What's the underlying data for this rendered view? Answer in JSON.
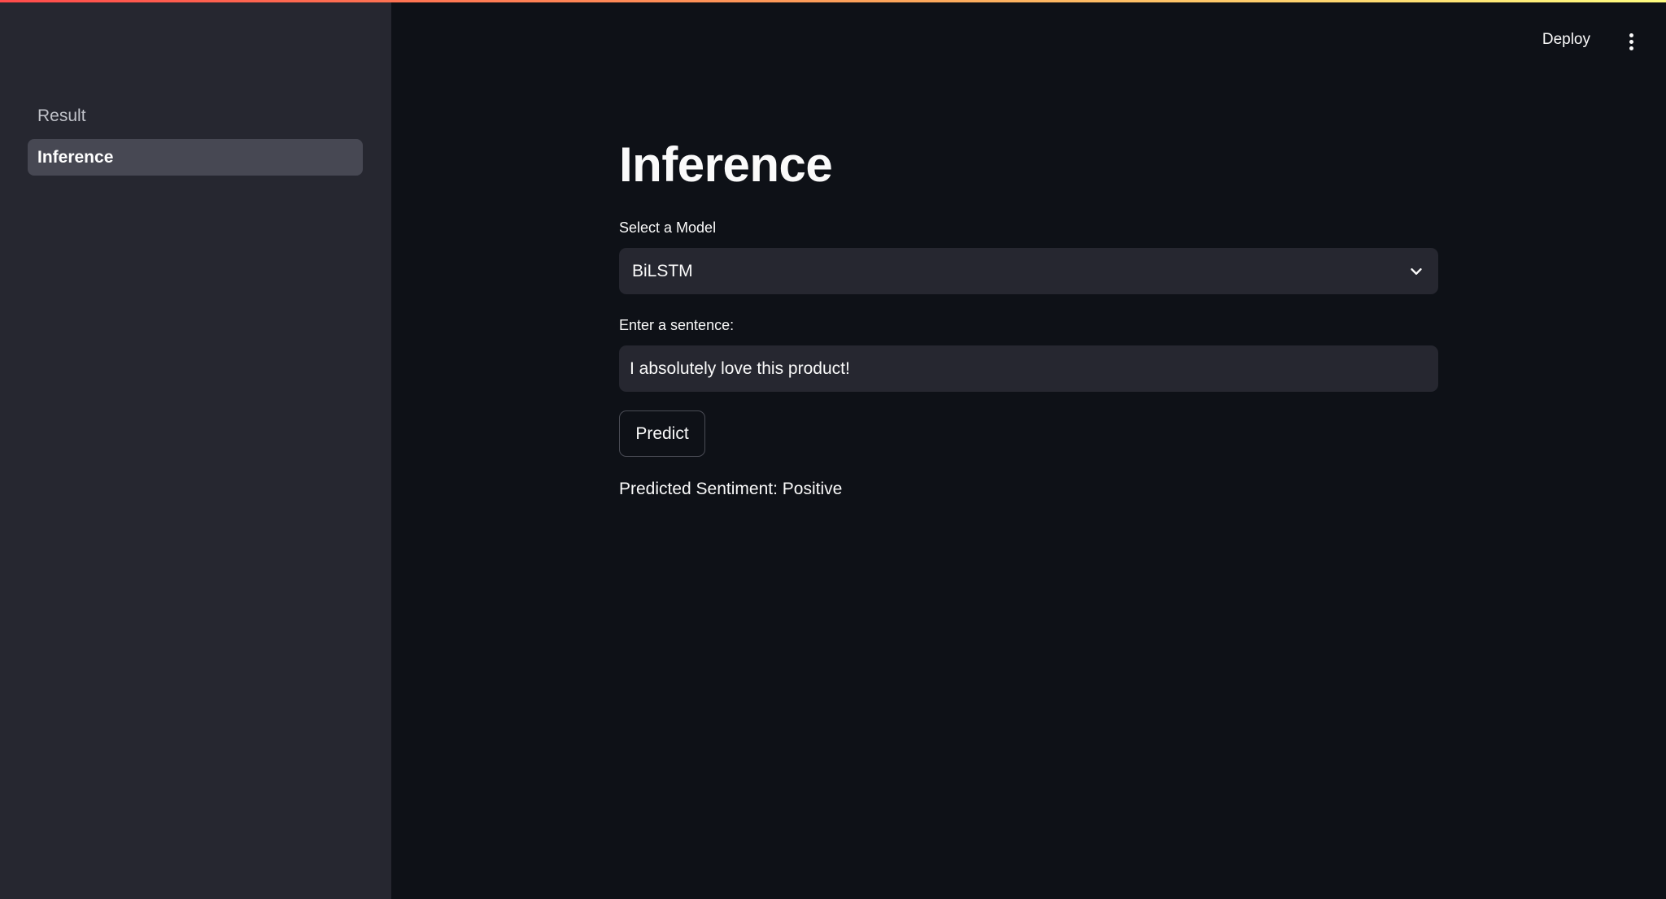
{
  "sidebar": {
    "items": [
      {
        "label": "Result",
        "active": false
      },
      {
        "label": "Inference",
        "active": true
      }
    ]
  },
  "header": {
    "deploy_label": "Deploy",
    "menu_icon": "kebab-menu-icon"
  },
  "main": {
    "title": "Inference",
    "model_select": {
      "label": "Select a Model",
      "value": "BiLSTM",
      "icon": "chevron-down-icon"
    },
    "sentence_input": {
      "label": "Enter a sentence:",
      "value": "I absolutely love this product!"
    },
    "predict_label": "Predict",
    "result": "Predicted Sentiment: Positive"
  },
  "colors": {
    "background": "#0e1117",
    "sidebar": "#262730",
    "active_item": "#474853",
    "accent_gradient_start": "#ff4b4b",
    "accent_gradient_end": "#fffd80"
  }
}
